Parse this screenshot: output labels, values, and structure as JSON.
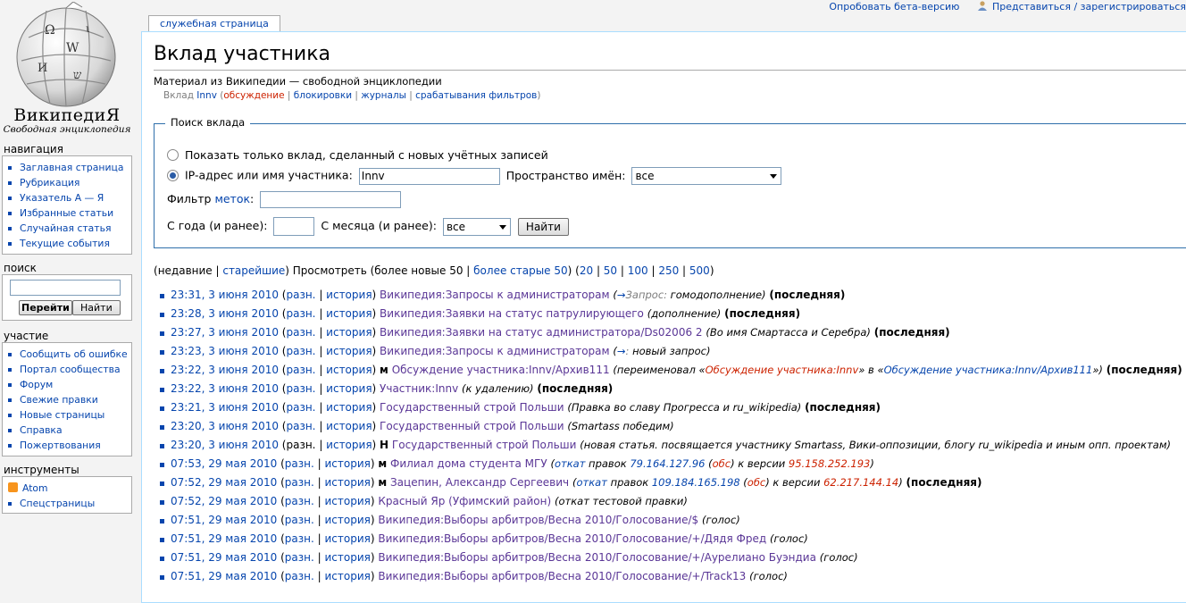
{
  "logo": {
    "wordmark": "ВикипедиЯ",
    "tagline": "Свободная энциклопедия"
  },
  "personal": {
    "beta": "Опробовать бета-версию",
    "login": "Представиться / зарегистрироваться"
  },
  "tab": {
    "label": "служебная страница"
  },
  "page": {
    "title": "Вклад участника",
    "site_sub": "Материал из Википедии — свободной энциклопедии",
    "sub": {
      "prefix": "Вклад ",
      "user": "Innv",
      "talk": "обсуждение",
      "blocks": "блокировки",
      "logs": "журналы",
      "filters": "срабатывания фильтров"
    }
  },
  "search_form": {
    "legend": "Поиск вклада",
    "radio_new": "Показать только вклад, сделанный с новых учётных записей",
    "radio_ip": "IP-адрес или имя участника:",
    "target_value": "Innv",
    "namespace_label": "Пространство имён:",
    "namespace_value": "все",
    "tag_filter_prefix": "Фильтр ",
    "tag_filter_link": "меток",
    "tag_filter_suffix": ":",
    "year_label": "С года (и ранее):",
    "month_label": "С месяца (и ранее):",
    "month_value": "все",
    "submit": "Найти"
  },
  "pager": {
    "open": "(",
    "recent": "недавние",
    "sep": " | ",
    "oldest": "старейшие",
    "view": ") Просмотреть (",
    "newer": "более новые 50",
    "older": "более старые 50",
    "mid": ") (",
    "n20": "20",
    "n50": "50",
    "n100": "100",
    "n250": "250",
    "n500": "500",
    "close": ")"
  },
  "labels": {
    "diff": "разн.",
    "hist": "история",
    "latest": "(последняя)"
  },
  "rows": [
    {
      "date": "23:31, 3 июня 2010",
      "diffLink": true,
      "flag": "",
      "title": "Википедия:Запросы к администраторам",
      "cmt_pre": "(",
      "cmt_arrow": "→",
      "cmt_gray": "Запрос:",
      "cmt_text": " гомодополнение)",
      "latest": true
    },
    {
      "date": "23:28, 3 июня 2010",
      "diffLink": true,
      "flag": "",
      "title": "Википедия:Заявки на статус патрулирующего",
      "cmt_pre": "(",
      "cmt_arrow": "",
      "cmt_gray": "",
      "cmt_text": "дополнение)",
      "latest": true
    },
    {
      "date": "23:27, 3 июня 2010",
      "diffLink": true,
      "flag": "",
      "title": "Википедия:Заявки на статус администратора/Ds02006 2",
      "cmt_pre": "(",
      "cmt_arrow": "",
      "cmt_gray": "",
      "cmt_text": "Во имя Смартасса и Серебра)",
      "latest": true
    },
    {
      "date": "23:23, 3 июня 2010",
      "diffLink": true,
      "flag": "",
      "title": "Википедия:Запросы к администраторам",
      "cmt_pre": "(",
      "cmt_arrow": "→",
      "cmt_gray": ":",
      "cmt_text": " новый запрос)",
      "latest": false
    },
    {
      "date": "23:22, 3 июня 2010",
      "diffLink": true,
      "flag": "м",
      "title": "Обсуждение участника:Innv/Архив111",
      "rename": {
        "pre": "(переименовал «",
        "from": "Обсуждение участника:Innv",
        "mid": "» в «",
        "to": "Обсуждение участника:Innv/Архив111",
        "post": "»)"
      },
      "latest": true
    },
    {
      "date": "23:22, 3 июня 2010",
      "diffLink": true,
      "flag": "",
      "title": "Участник:Innv",
      "cmt_pre": "(",
      "cmt_arrow": "",
      "cmt_gray": "",
      "cmt_text": "к удалению)",
      "latest": true
    },
    {
      "date": "23:21, 3 июня 2010",
      "diffLink": true,
      "flag": "",
      "title": "Государственный строй Польши",
      "cmt_pre": "(",
      "cmt_arrow": "",
      "cmt_gray": "",
      "cmt_text": "Правка во славу Прогресса и ru_wikipedia)",
      "latest": true
    },
    {
      "date": "23:20, 3 июня 2010",
      "diffLink": true,
      "flag": "",
      "title": "Государственный строй Польши",
      "cmt_pre": "(",
      "cmt_arrow": "",
      "cmt_gray": "",
      "cmt_text": "Smartass победим)",
      "latest": false
    },
    {
      "date": "23:20, 3 июня 2010",
      "diffLink": false,
      "flag": "Н",
      "title": "Государственный строй Польши",
      "cmt_pre": "(",
      "cmt_arrow": "",
      "cmt_gray": "",
      "cmt_text": "новая статья. посвящается участнику Smartass, Вики-оппозиции, блогу ru_wikipedia и иным опп. проектам)",
      "latest": false
    },
    {
      "date": "07:53, 29 мая 2010",
      "diffLink": true,
      "flag": "м",
      "title": "Филиал дома студента МГУ",
      "revert": {
        "link": "откат",
        "pre": " правок ",
        "ip": "79.164.127.96",
        "talk": "обс",
        "mid": " к версии ",
        "ver": "95.158.252.193"
      },
      "latest": false
    },
    {
      "date": "07:52, 29 мая 2010",
      "diffLink": true,
      "flag": "м",
      "title": "Зацепин, Александр Сергеевич",
      "revert": {
        "link": "откат",
        "pre": " правок ",
        "ip": "109.184.165.198",
        "talk": "обс",
        "mid": " к версии ",
        "ver": "62.217.144.14"
      },
      "latest": true
    },
    {
      "date": "07:52, 29 мая 2010",
      "diffLink": true,
      "flag": "",
      "title": "Красный Яр (Уфимский район)",
      "cmt_pre": "(",
      "cmt_arrow": "",
      "cmt_gray": "",
      "cmt_text": "откат тестовой правки)",
      "latest": false
    },
    {
      "date": "07:51, 29 мая 2010",
      "diffLink": true,
      "flag": "",
      "title": "Википедия:Выборы арбитров/Весна 2010/Голосование/$",
      "cmt_pre": "(",
      "cmt_arrow": "",
      "cmt_gray": "",
      "cmt_text": "голос)",
      "latest": false
    },
    {
      "date": "07:51, 29 мая 2010",
      "diffLink": true,
      "flag": "",
      "title": "Википедия:Выборы арбитров/Весна 2010/Голосование/+/Дядя Фред",
      "cmt_pre": "(",
      "cmt_arrow": "",
      "cmt_gray": "",
      "cmt_text": "голос)",
      "latest": false
    },
    {
      "date": "07:51, 29 мая 2010",
      "diffLink": true,
      "flag": "",
      "title": "Википедия:Выборы арбитров/Весна 2010/Голосование/+/Аурелиано Буэндиа",
      "cmt_pre": "(",
      "cmt_arrow": "",
      "cmt_gray": "",
      "cmt_text": "голос)",
      "latest": false
    },
    {
      "date": "07:51, 29 мая 2010",
      "diffLink": true,
      "flag": "",
      "title": "Википедия:Выборы арбитров/Весна 2010/Голосование/+/Track13",
      "cmt_pre": "(",
      "cmt_arrow": "",
      "cmt_gray": "",
      "cmt_text": "голос)",
      "latest": false
    }
  ],
  "sidebar": {
    "nav_title": "навигация",
    "nav": [
      "Заглавная страница",
      "Рубрикация",
      "Указатель А — Я",
      "Избранные статьи",
      "Случайная статья",
      "Текущие события"
    ],
    "search_title": "поиск",
    "go": "Перейти",
    "search": "Найти",
    "part_title": "участие",
    "part": [
      "Сообщить об ошибке",
      "Портал сообщества",
      "Форум",
      "Свежие правки",
      "Новые страницы",
      "Справка",
      "Пожертвования"
    ],
    "tools_title": "инструменты",
    "tools": [
      "Atom",
      "Спецстраницы"
    ]
  },
  "colors": {
    "link": "#0645ad",
    "redlink": "#cc2200",
    "visited": "#5a3696",
    "border": "#aaddff"
  }
}
